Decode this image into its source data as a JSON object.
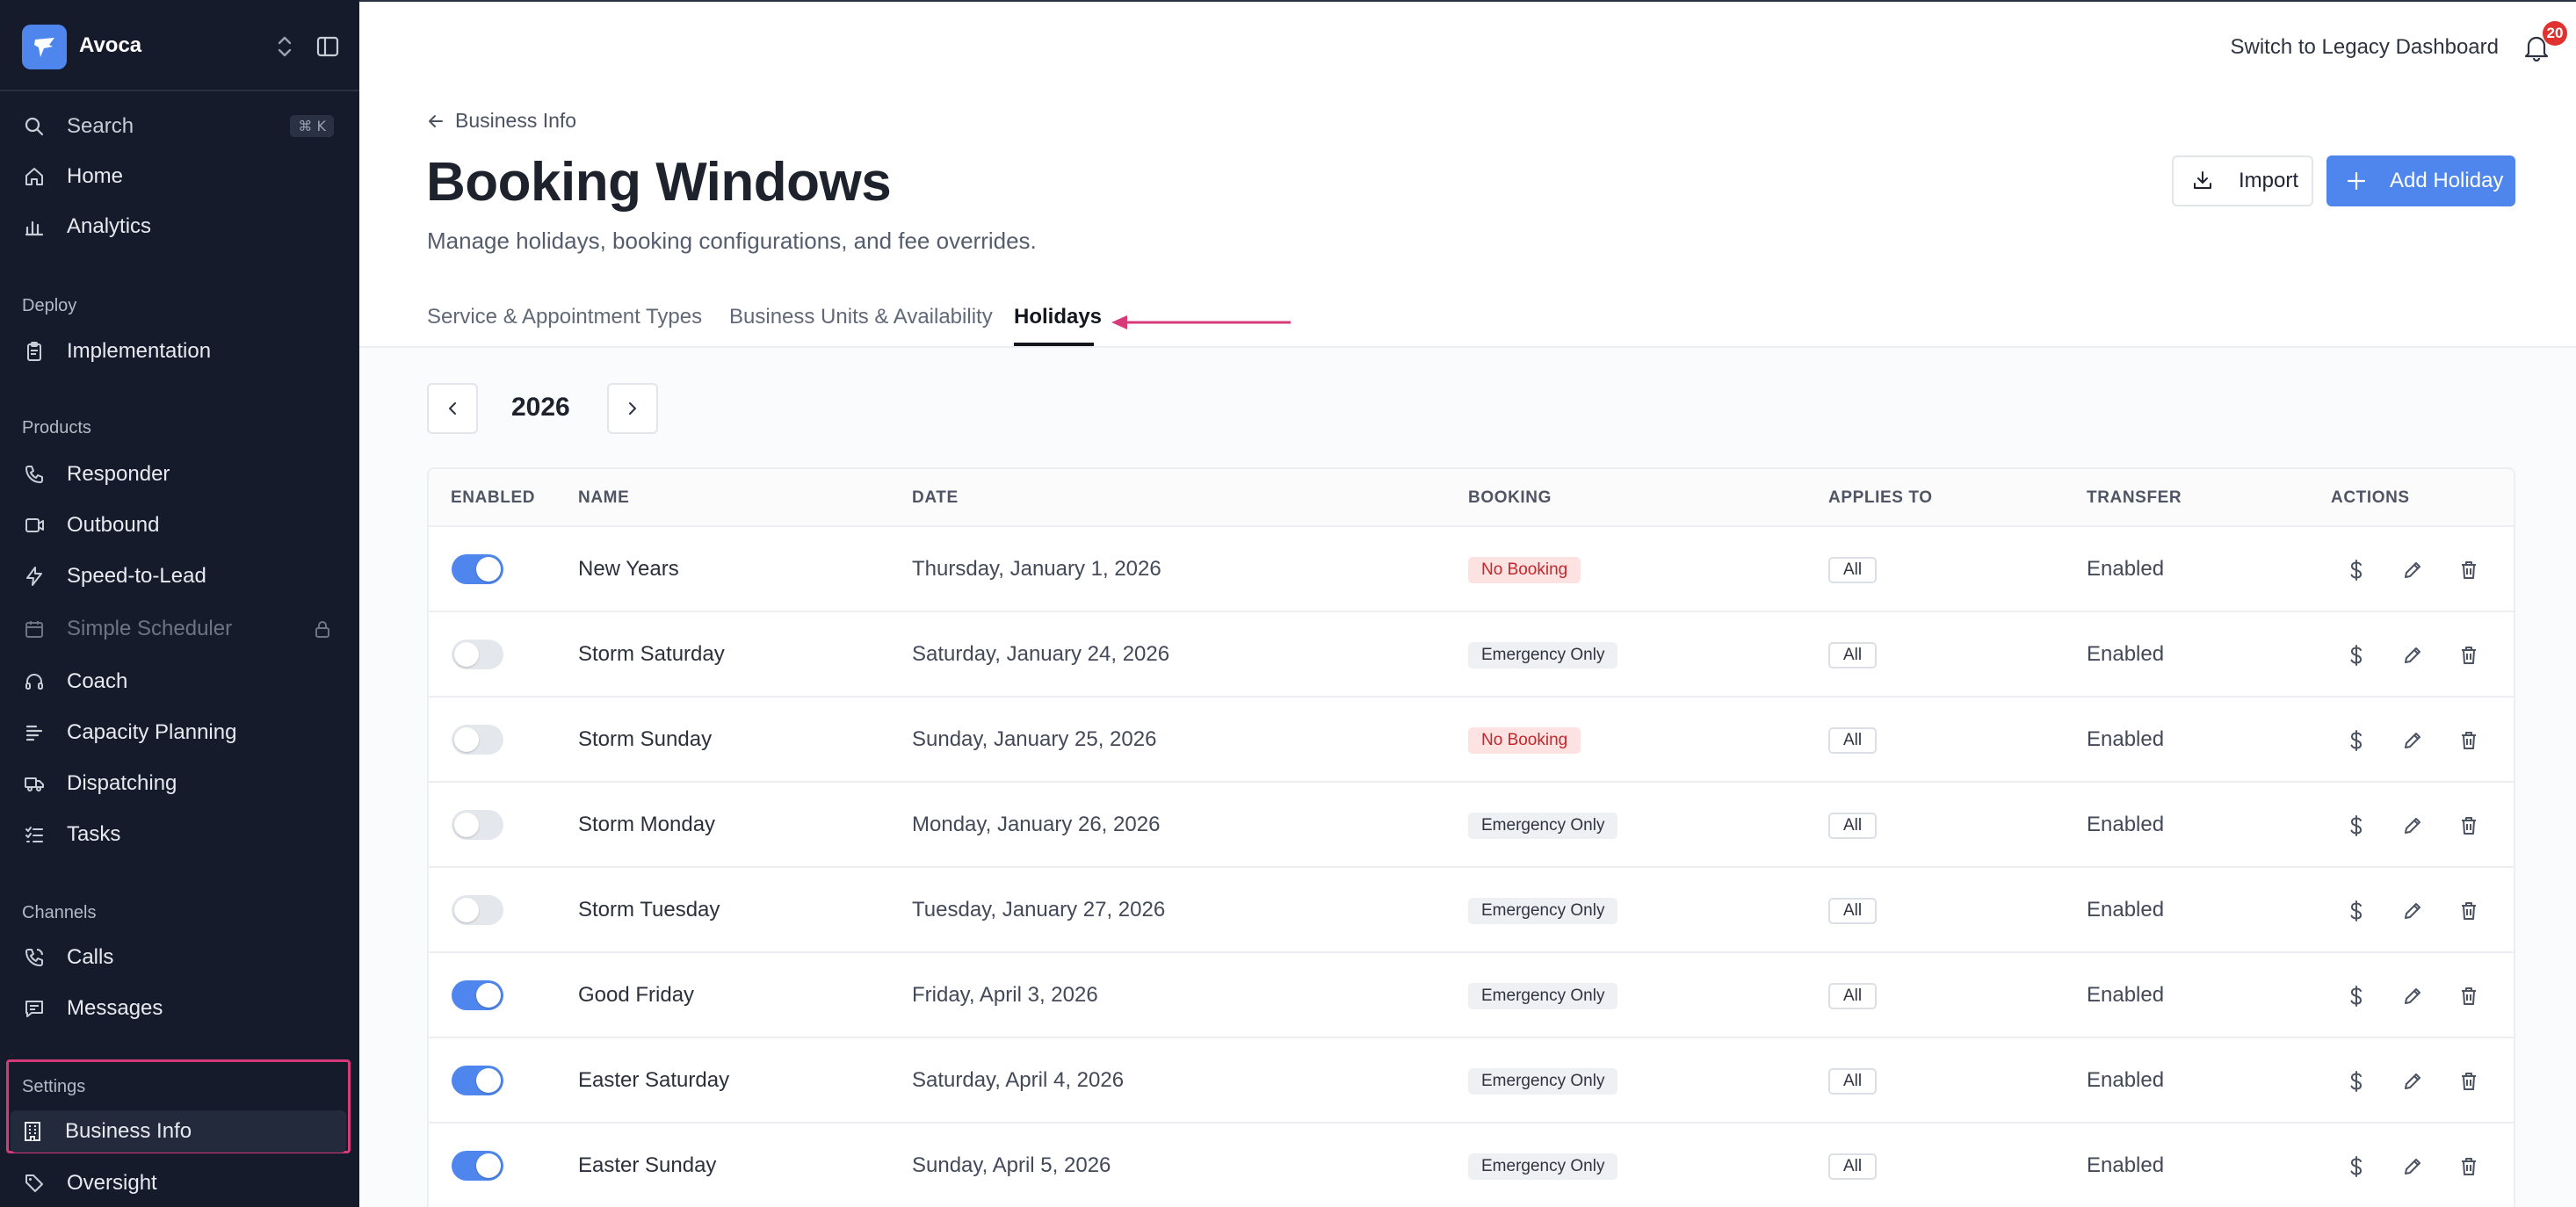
{
  "sidebar": {
    "org_name": "Avoca",
    "search": {
      "label": "Search",
      "shortcut": "⌘ K"
    },
    "top_items": [
      {
        "label": "Home",
        "icon": "home-icon"
      },
      {
        "label": "Analytics",
        "icon": "bar-chart-icon"
      }
    ],
    "sections": {
      "deploy": "Deploy",
      "products": "Products",
      "channels": "Channels",
      "settings": "Settings"
    },
    "deploy_items": [
      {
        "label": "Implementation",
        "icon": "clipboard-icon"
      }
    ],
    "product_items": [
      {
        "label": "Responder",
        "icon": "phone-icon"
      },
      {
        "label": "Outbound",
        "icon": "outbound-icon"
      },
      {
        "label": "Speed-to-Lead",
        "icon": "lightning-icon"
      },
      {
        "label": "Simple Scheduler",
        "icon": "calendar-icon",
        "disabled": true
      },
      {
        "label": "Coach",
        "icon": "headset-icon"
      },
      {
        "label": "Capacity Planning",
        "icon": "capacity-icon"
      },
      {
        "label": "Dispatching",
        "icon": "truck-icon"
      },
      {
        "label": "Tasks",
        "icon": "tasks-icon"
      }
    ],
    "channel_items": [
      {
        "label": "Calls",
        "icon": "phone-call-icon"
      },
      {
        "label": "Messages",
        "icon": "message-icon"
      }
    ],
    "settings_items": [
      {
        "label": "Business Info",
        "icon": "building-icon",
        "active": true
      },
      {
        "label": "Oversight",
        "icon": "tag-icon"
      }
    ]
  },
  "topbar": {
    "legacy_link": "Switch to Legacy Dashboard",
    "notification_count": "20"
  },
  "header": {
    "breadcrumb": "Business Info",
    "title": "Booking Windows",
    "subtitle": "Manage holidays, booking configurations, and fee overrides.",
    "import_label": "Import",
    "add_label": "Add Holiday"
  },
  "tabs": [
    {
      "label": "Service & Appointment Types"
    },
    {
      "label": "Business Units & Availability"
    },
    {
      "label": "Holidays",
      "active": true
    }
  ],
  "year": "2026",
  "table": {
    "columns": [
      "ENABLED",
      "NAME",
      "DATE",
      "BOOKING",
      "APPLIES TO",
      "TRANSFER",
      "ACTIONS"
    ],
    "rows": [
      {
        "enabled": true,
        "name": "New Years",
        "date": "Thursday, January 1, 2026",
        "booking": "No Booking",
        "applies": "All",
        "transfer": "Enabled"
      },
      {
        "enabled": false,
        "name": "Storm Saturday",
        "date": "Saturday, January 24, 2026",
        "booking": "Emergency Only",
        "applies": "All",
        "transfer": "Enabled"
      },
      {
        "enabled": false,
        "name": "Storm Sunday",
        "date": "Sunday, January 25, 2026",
        "booking": "No Booking",
        "applies": "All",
        "transfer": "Enabled"
      },
      {
        "enabled": false,
        "name": "Storm Monday",
        "date": "Monday, January 26, 2026",
        "booking": "Emergency Only",
        "applies": "All",
        "transfer": "Enabled"
      },
      {
        "enabled": false,
        "name": "Storm Tuesday",
        "date": "Tuesday, January 27, 2026",
        "booking": "Emergency Only",
        "applies": "All",
        "transfer": "Enabled"
      },
      {
        "enabled": true,
        "name": "Good Friday",
        "date": "Friday, April 3, 2026",
        "booking": "Emergency Only",
        "applies": "All",
        "transfer": "Enabled"
      },
      {
        "enabled": true,
        "name": "Easter Saturday",
        "date": "Saturday, April 4, 2026",
        "booking": "Emergency Only",
        "applies": "All",
        "transfer": "Enabled"
      },
      {
        "enabled": true,
        "name": "Easter Sunday",
        "date": "Sunday, April 5, 2026",
        "booking": "Emergency Only",
        "applies": "All",
        "transfer": "Enabled"
      }
    ]
  },
  "colors": {
    "sidebar_bg": "#151b2b",
    "accent": "#4f86ee",
    "annotation": "#d63a79",
    "no_booking_bg": "#fde2e2",
    "no_booking_text": "#c4262a"
  }
}
